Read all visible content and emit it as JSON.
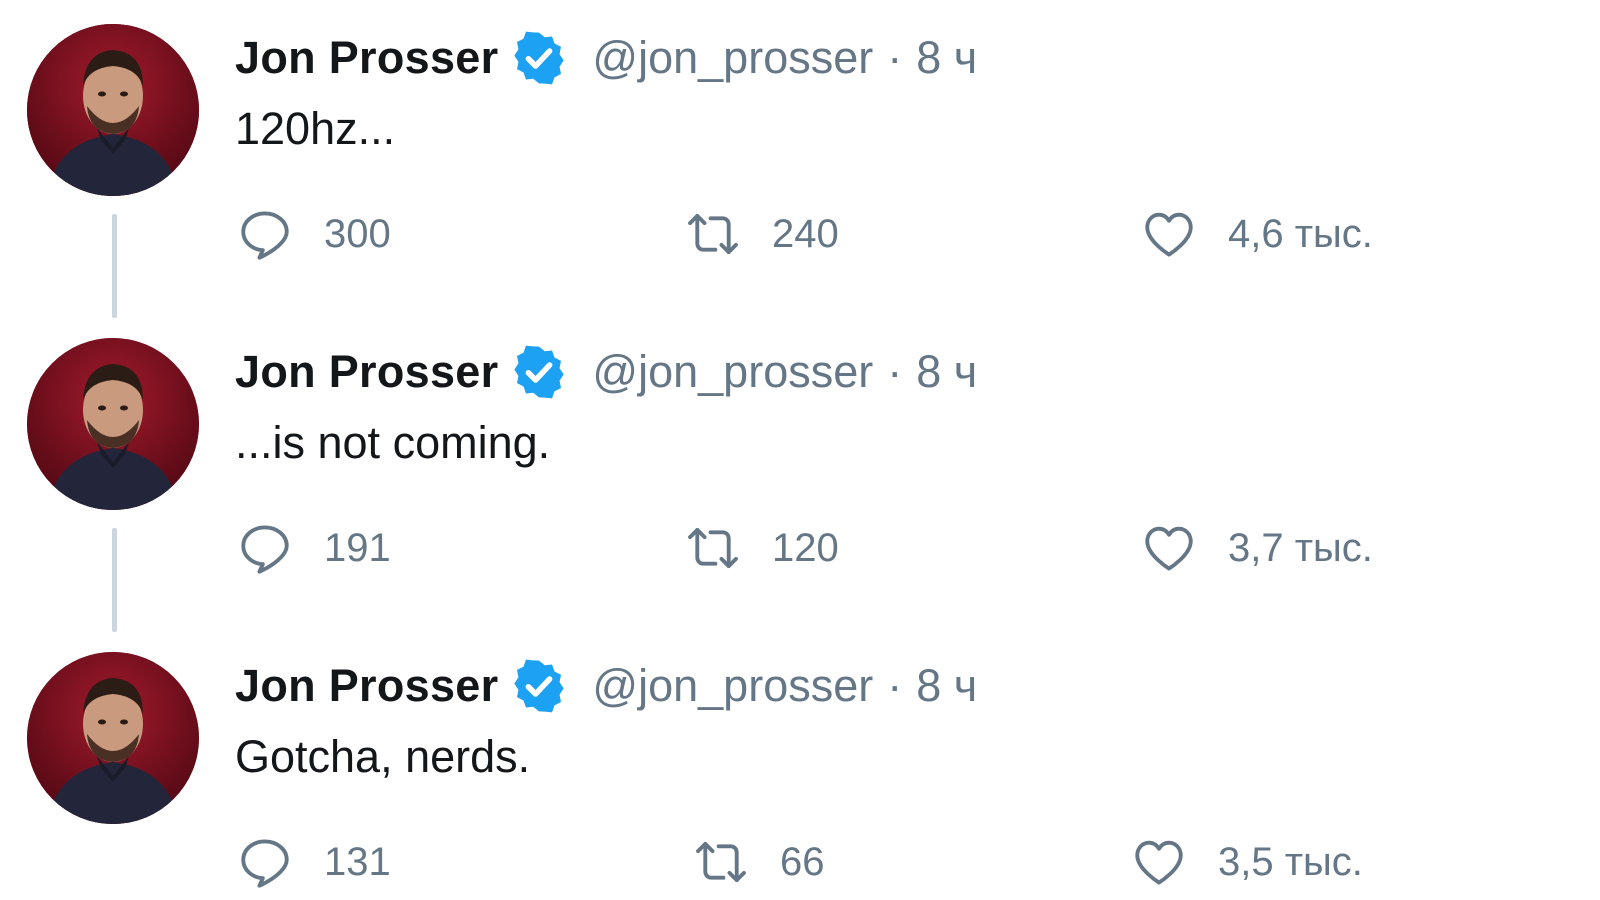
{
  "author": {
    "name": "Jon Prosser",
    "handle": "@jon_prosser",
    "verified": true,
    "separator": "·"
  },
  "colors": {
    "verified_badge": "#1da1f2",
    "secondary_text": "#657786",
    "primary_text": "#14171a",
    "thread_line": "#ccd6dd",
    "avatar_background": "#7d1020"
  },
  "icons": {
    "reply": "speech-bubble-icon",
    "retweet": "retweet-arrows-icon",
    "like": "heart-icon",
    "verified": "verified-badge-icon"
  },
  "tweets": [
    {
      "time": "8 ч",
      "text": "120hz...",
      "replies": "300",
      "retweets": "240",
      "likes": "4,6 тыс."
    },
    {
      "time": "8 ч",
      "text": "...is not coming.",
      "replies": "191",
      "retweets": "120",
      "likes": "3,7 тыс."
    },
    {
      "time": "8 ч",
      "text": "Gotcha, nerds.",
      "replies": "131",
      "retweets": "66",
      "likes": "3,5 тыс."
    }
  ]
}
